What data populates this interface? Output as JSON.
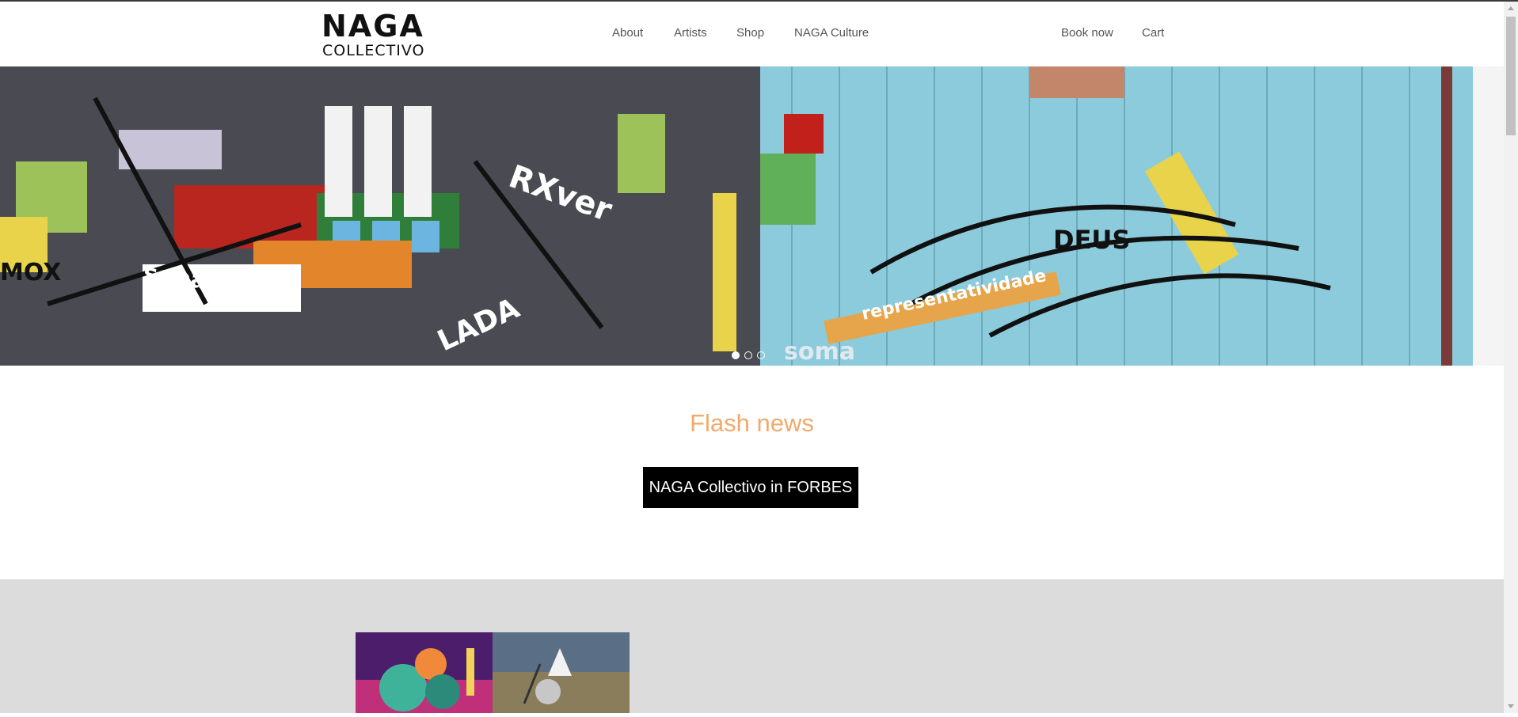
{
  "brand": {
    "logo_word": "NAGA",
    "logo_sub": "COLLECTIVO"
  },
  "nav": {
    "items": [
      {
        "label": "About"
      },
      {
        "label": "Artists"
      },
      {
        "label": "Shop"
      },
      {
        "label": "NAGA Culture"
      }
    ],
    "right": [
      {
        "label": "Book now"
      },
      {
        "label": "Cart"
      }
    ]
  },
  "hero": {
    "slide_count": 3,
    "active_slide": 1,
    "mural_text": [
      "sebastião",
      "RXver",
      "representatividade",
      "soma",
      "DEUS",
      "LADA",
      "MOX"
    ]
  },
  "flash": {
    "title": "Flash news",
    "button_label": "NAGA Collectivo in FORBES"
  },
  "colors": {
    "accent": "#f2a96b",
    "button_bg": "#000000",
    "section_bg": "#dcdcdc"
  }
}
